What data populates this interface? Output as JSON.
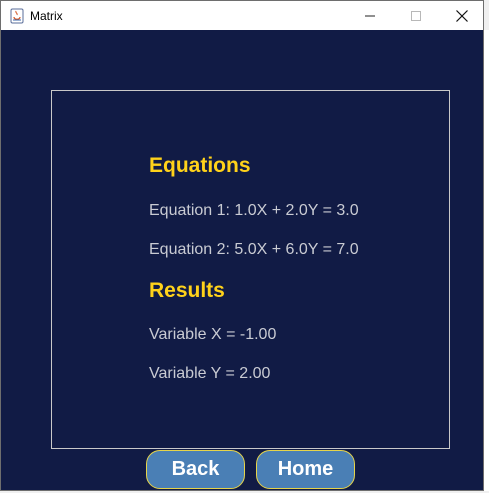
{
  "window": {
    "title": "Matrix",
    "controls": {
      "minimize": "—",
      "maximize": "☐",
      "close": "✕"
    },
    "icon": "java-app-icon"
  },
  "equations": {
    "heading": "Equations",
    "items": [
      "Equation 1: 1.0X + 2.0Y = 3.0",
      "Equation 2: 5.0X + 6.0Y = 7.0"
    ]
  },
  "results": {
    "heading": "Results",
    "items": [
      "Variable X = -1.00",
      "Variable Y = 2.00"
    ]
  },
  "buttons": {
    "back": "Back",
    "home": "Home"
  },
  "colors": {
    "background": "#111b45",
    "heading": "#ffd21a",
    "text": "#c9cbd3",
    "button": "#4a7fb5",
    "button_border": "#e6d44a"
  }
}
